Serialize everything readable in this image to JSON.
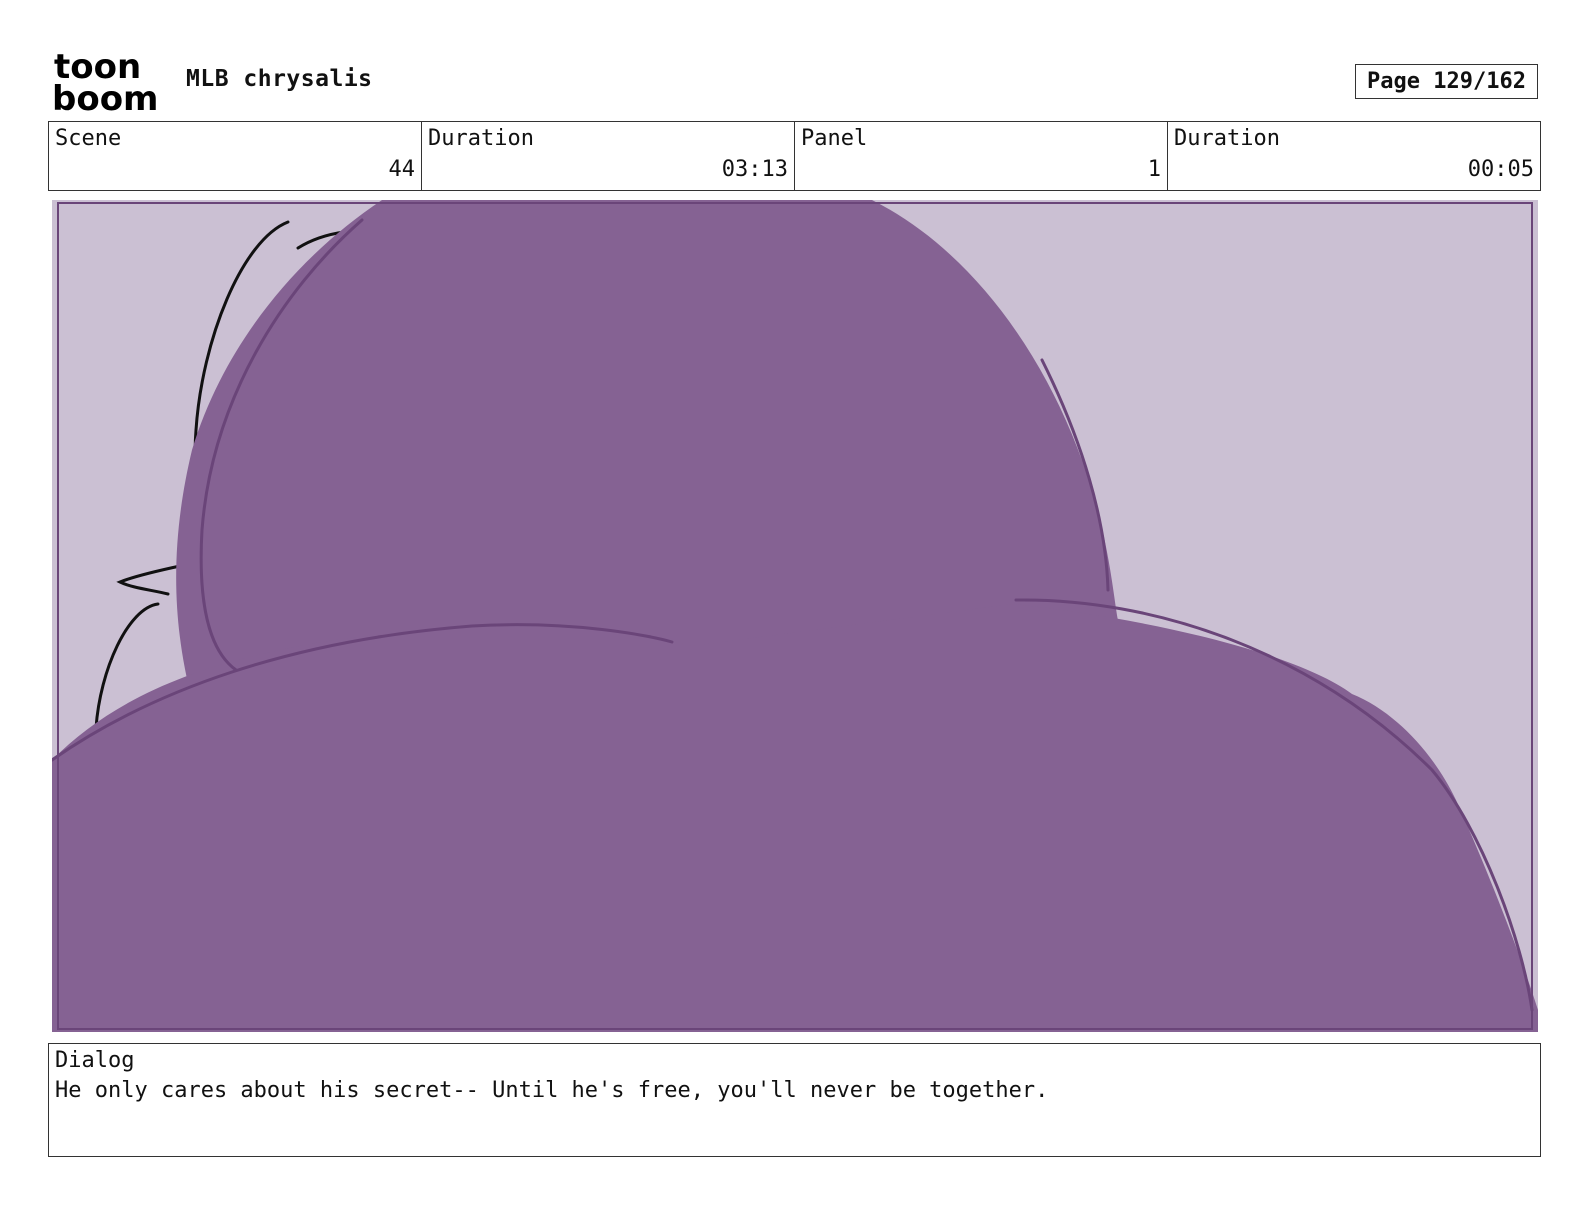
{
  "header": {
    "logo": {
      "icon": "toon-boom-logo",
      "text_top": "toon",
      "text_bottom": "boom"
    },
    "project_title": "MLB chrysalis",
    "page_label": "Page 129/162"
  },
  "info": {
    "scene_label": "Scene",
    "scene_value": "44",
    "scene_duration_label": "Duration",
    "scene_duration_value": "03:13",
    "panel_label": "Panel",
    "panel_value": "1",
    "panel_duration_label": "Duration",
    "panel_duration_value": "00:05"
  },
  "panel_image": {
    "background_color": "#cbc0d3",
    "silhouette_color": "#856293",
    "outline_color": "#6a4579",
    "sketch_color": "#111111"
  },
  "dialog": {
    "label": "Dialog",
    "text": "He only cares about his secret-- Until he's free, you'll never be together."
  }
}
